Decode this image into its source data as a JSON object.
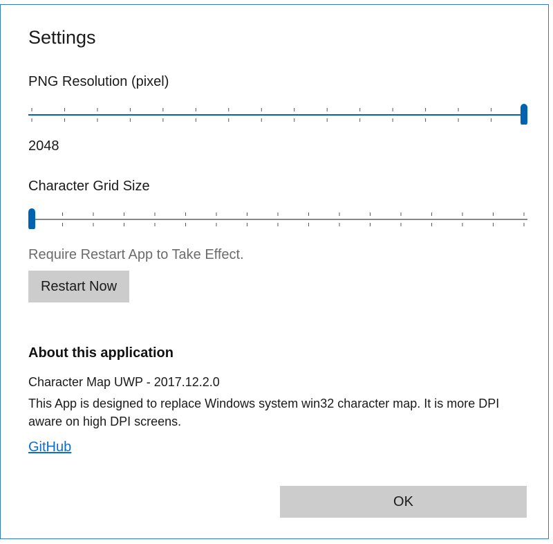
{
  "dialog": {
    "title": "Settings"
  },
  "png_resolution": {
    "label": "PNG Resolution (pixel)",
    "value_text": "2048",
    "level": 1.0,
    "tick_count": 16,
    "accent_color": "#0063b1"
  },
  "grid_size": {
    "label": "Character Grid Size",
    "level": 0.0,
    "tick_count": 17,
    "accent_color": "#0063b1"
  },
  "restart": {
    "note": "Require Restart App to Take Effect.",
    "button_label": "Restart Now"
  },
  "about": {
    "heading": "About this application",
    "version": "Character Map UWP - 2017.12.2.0",
    "description": "This App is designed to replace Windows system win32 character map. It is more DPI aware on high DPI screens.",
    "link_label": "GitHub"
  },
  "footer": {
    "ok_label": "OK"
  }
}
